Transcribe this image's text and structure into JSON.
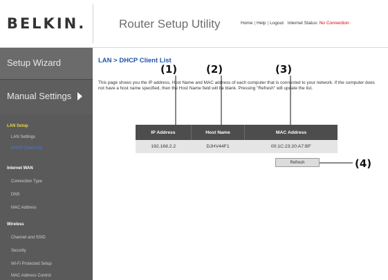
{
  "header": {
    "logo": "BELKIN.",
    "app_title": "Router Setup Utility",
    "links": {
      "home": "Home",
      "help": "Help",
      "logout": "Logout"
    },
    "status_label": "Internet Status:",
    "status_value": "No Connection"
  },
  "sidebar": {
    "setup_wizard": "Setup Wizard",
    "manual_settings": "Manual Settings",
    "sections": [
      {
        "heading": "LAN Setup",
        "items": [
          "LAN Settings",
          "DHCP Client List"
        ]
      },
      {
        "heading": "Internet WAN",
        "items": [
          "Connection Type",
          "DNS",
          "MAC Address"
        ]
      },
      {
        "heading": "Wireless",
        "items": [
          "Channel and SSID",
          "Security",
          "Wi-Fi Protected Setup",
          "MAC Address Control"
        ]
      }
    ]
  },
  "main": {
    "breadcrumb": "LAN > DHCP Client List",
    "description": "This page shows you the IP address, Host Name and MAC address of each computer that is connected to your network. If the computer does not have a host name specified, then the Host Name field will be blank. Pressing \"Refresh\" will update the list.",
    "table": {
      "headers": [
        "IP Address",
        "Host Name",
        "MAC Address"
      ],
      "rows": [
        [
          "192.168.2.2",
          "DJHV44F1",
          "00:1C:23:20:A7:BF"
        ]
      ]
    },
    "refresh_label": "Refresh"
  },
  "callouts": [
    "(1)",
    "(2)",
    "(3)",
    "(4)"
  ]
}
